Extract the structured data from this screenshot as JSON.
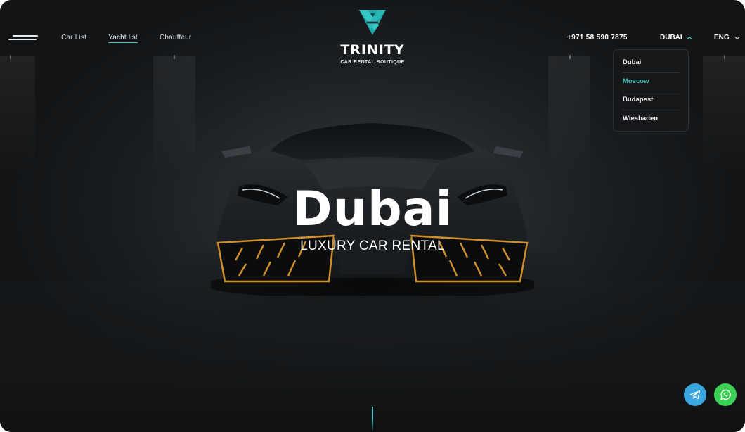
{
  "nav": {
    "links": [
      {
        "label": "Car List",
        "active": false
      },
      {
        "label": "Yacht list",
        "active": true
      },
      {
        "label": "Chauffeur",
        "active": false
      }
    ]
  },
  "logo": {
    "name": "TRINITY",
    "tagline": "CAR RENTAL BOUTIQUE",
    "icon": "trinity-logo-icon"
  },
  "header": {
    "phone": "+971 58 590 7875",
    "city": "DUBAI",
    "language": "ENG"
  },
  "city_dropdown": {
    "open": true,
    "options": [
      {
        "label": "Dubai",
        "selected": false
      },
      {
        "label": "Moscow",
        "selected": true
      },
      {
        "label": "Budapest",
        "selected": false
      },
      {
        "label": "Wiesbaden",
        "selected": false
      }
    ]
  },
  "hero": {
    "title": "Dubai",
    "subtitle": "LUXURY CAR RENTAL"
  },
  "fab": {
    "telegram_icon": "telegram-icon",
    "whatsapp_icon": "whatsapp-icon"
  },
  "colors": {
    "accent": "#43c3c3",
    "telegram": "#39a6e0",
    "whatsapp": "#3bcf54",
    "background": "#1a1d1f"
  }
}
